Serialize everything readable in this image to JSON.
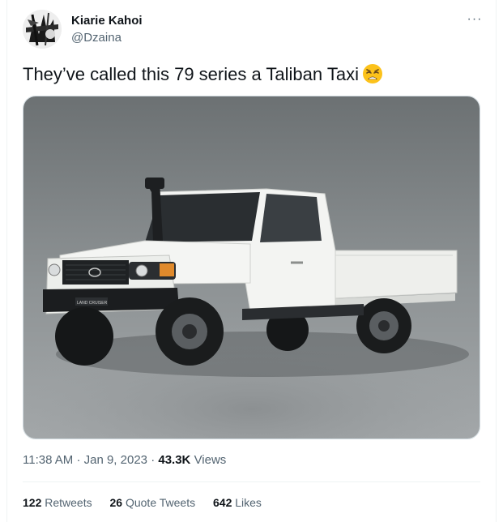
{
  "author": {
    "display_name": "Kiarie Kahoi",
    "handle": "@Dzaina",
    "avatar_icon": "avatar-image"
  },
  "more_label": "···",
  "tweet": {
    "text": "They’ve called this 79 series a Taliban Taxi",
    "emoji_icon": "weary-face-emoji",
    "media_icon": "white-pickup-truck-photo",
    "badge_text": "LAND CRUISER"
  },
  "meta": {
    "time": "11:38 AM",
    "sep1": "·",
    "date": "Jan 9, 2023",
    "sep2": "·",
    "views_count": "43.3K",
    "views_label": "Views"
  },
  "stats": {
    "retweets_count": "122",
    "retweets_label": "Retweets",
    "quotes_count": "26",
    "quotes_label": "Quote Tweets",
    "likes_count": "642",
    "likes_label": "Likes"
  },
  "colors": {
    "text_primary": "#0f1419",
    "text_secondary": "#536471",
    "border": "#eff3f4",
    "photo_bg_top": "#6f7476",
    "photo_bg_bottom": "#9ea3a5",
    "truck_body": "#f2f3f1"
  }
}
